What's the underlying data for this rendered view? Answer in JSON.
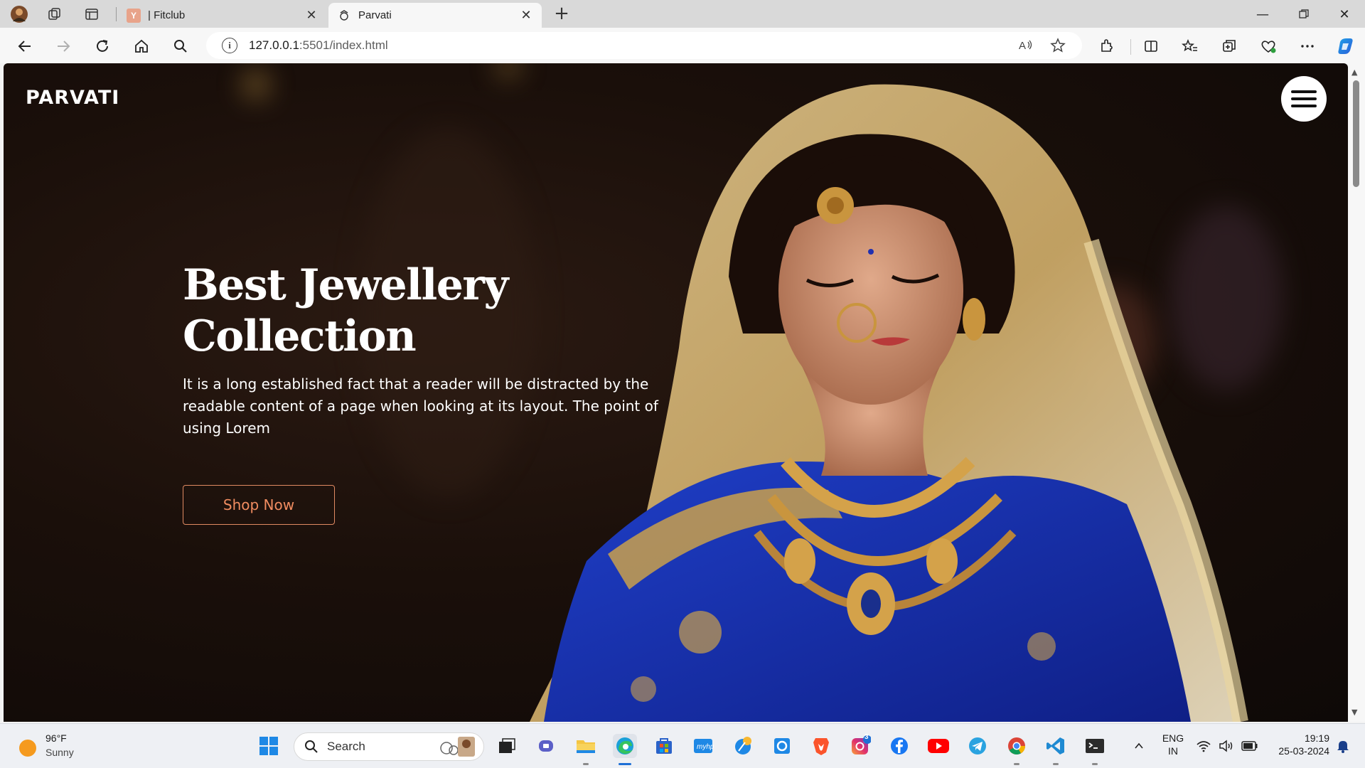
{
  "browser": {
    "tabs": [
      {
        "title": "| Fitclub",
        "favicon": "fitclub-favicon"
      },
      {
        "title": "Parvati",
        "favicon": "parvati-favicon",
        "active": true
      }
    ],
    "address": {
      "host": "127.0.0.1",
      "rest": ":5501/index.html"
    }
  },
  "site": {
    "logo": "PARVATI",
    "hero": {
      "title_line1": "Best Jewellery",
      "title_line2": "Collection",
      "text": "It is a long established fact that a reader will be distracted by the readable content of a page when looking at its layout. The point of using Lorem",
      "button": "Shop Now"
    },
    "colors": {
      "accent": "#f08c60",
      "background": "#140c08"
    }
  },
  "taskbar": {
    "weather": {
      "temp": "96°F",
      "desc": "Sunny"
    },
    "search_label": "Search",
    "instagram_badge": "3",
    "tray": {
      "lang": "ENG",
      "region": "IN",
      "time": "19:19",
      "date": "25-03-2024"
    }
  }
}
